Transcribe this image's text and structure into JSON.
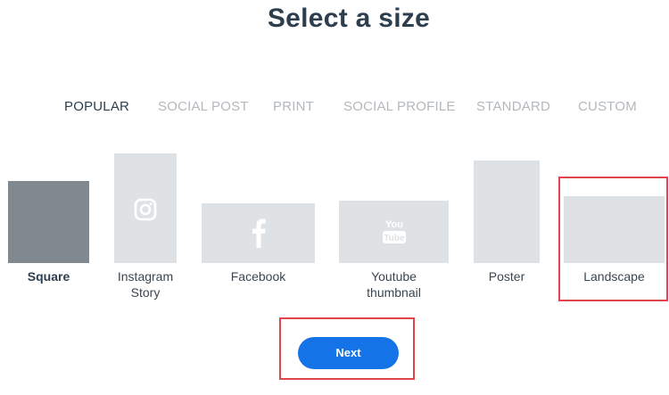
{
  "page": {
    "title": "Select a size"
  },
  "tabs": [
    {
      "label": "POPULAR",
      "active": true
    },
    {
      "label": "SOCIAL POST",
      "active": false
    },
    {
      "label": "PRINT",
      "active": false
    },
    {
      "label": "SOCIAL PROFILE",
      "active": false
    },
    {
      "label": "STANDARD",
      "active": false
    },
    {
      "label": "CUSTOM",
      "active": false
    }
  ],
  "sizes": [
    {
      "label": "Square",
      "selected": true,
      "icon": null
    },
    {
      "label_line1": "Instagram",
      "label_line2": "Story",
      "selected": false,
      "icon": "instagram-icon"
    },
    {
      "label": "Facebook",
      "selected": false,
      "icon": "facebook-icon"
    },
    {
      "label_line1": "Youtube",
      "label_line2": "thumbnail",
      "selected": false,
      "icon": "youtube-icon"
    },
    {
      "label": "Poster",
      "selected": false,
      "icon": null
    },
    {
      "label": "Landscape",
      "selected": false,
      "icon": null
    }
  ],
  "actions": {
    "next_label": "Next"
  },
  "colors": {
    "accent": "#1473e6",
    "selected_thumb": "#7f898f",
    "thumb": "#dfe2e4",
    "highlight": "#e0454b",
    "title": "#2d3e4f",
    "inactive_tab": "#b3b8bd"
  }
}
